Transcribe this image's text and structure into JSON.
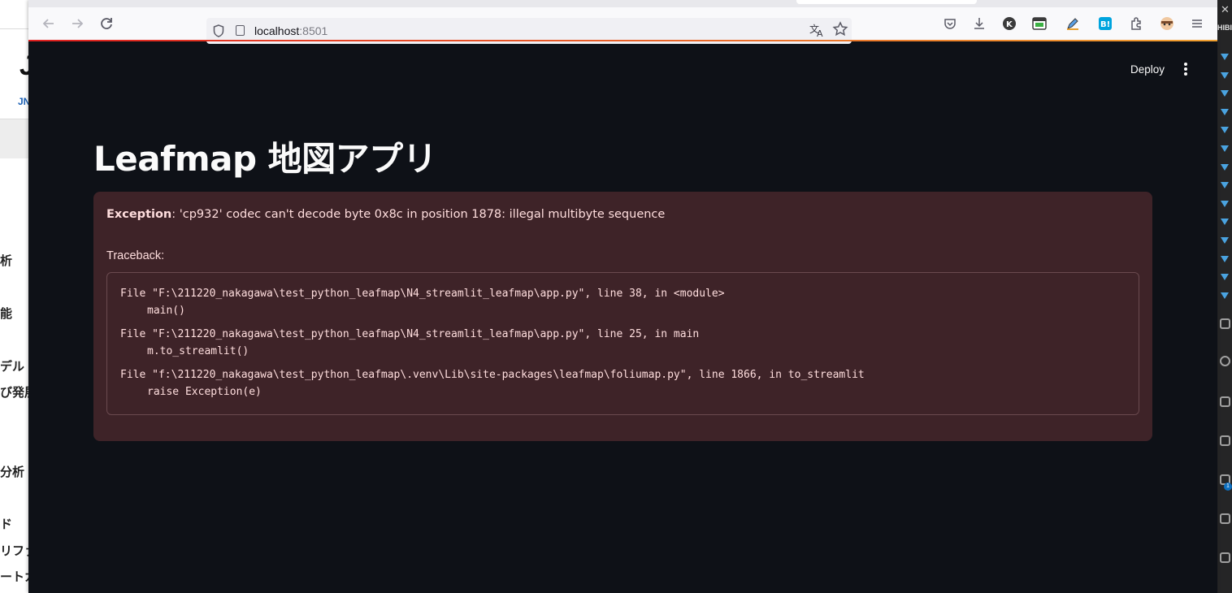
{
  "browser": {
    "url_host": "localhost",
    "url_port": ":8501"
  },
  "background_left": {
    "logo": "J",
    "logo_sub": "JN",
    "fragments": [
      "析",
      "能",
      "デル",
      "び発展",
      "分析",
      "ド",
      "リファ",
      "ートカ"
    ]
  },
  "background_right": {
    "close_glyph": "✕",
    "label": "HIBI",
    "badge": "1"
  },
  "header": {
    "deploy_label": "Deploy"
  },
  "main": {
    "title": "Leafmap 地図アプリ"
  },
  "error": {
    "label": "Exception",
    "message": ": 'cp932' codec can't decode byte 0x8c in position 1878: illegal multibyte sequence",
    "traceback_label": "Traceback:",
    "frames": [
      {
        "location": "File \"F:\\211220_nakagawa\\test_python_leafmap\\N4_streamlit_leafmap\\app.py\", line 38, in <module>",
        "code": "main()"
      },
      {
        "location": "File \"F:\\211220_nakagawa\\test_python_leafmap\\N4_streamlit_leafmap\\app.py\", line 25, in main",
        "code": "m.to_streamlit()"
      },
      {
        "location": "File \"f:\\211220_nakagawa\\test_python_leafmap\\.venv\\Lib\\site-packages\\leafmap\\foliumap.py\", line 1866, in to_streamlit",
        "code": "raise Exception(e)"
      }
    ]
  },
  "colors": {
    "app_background": "#0e1117",
    "error_background": "#3e2328",
    "error_text": "#ffdede",
    "title_text": "#fafafa"
  },
  "icons": {
    "toolbar": [
      "back-icon",
      "forward-icon",
      "reload-icon",
      "shield-icon",
      "page-icon",
      "translate-icon",
      "bookmark-star-icon",
      "pocket-icon",
      "download-icon",
      "kagi-icon",
      "calendar-icon",
      "pen-icon",
      "hatena-bookmark-icon",
      "extensions-icon",
      "profile-avatar-icon",
      "hamburger-menu-icon"
    ]
  }
}
